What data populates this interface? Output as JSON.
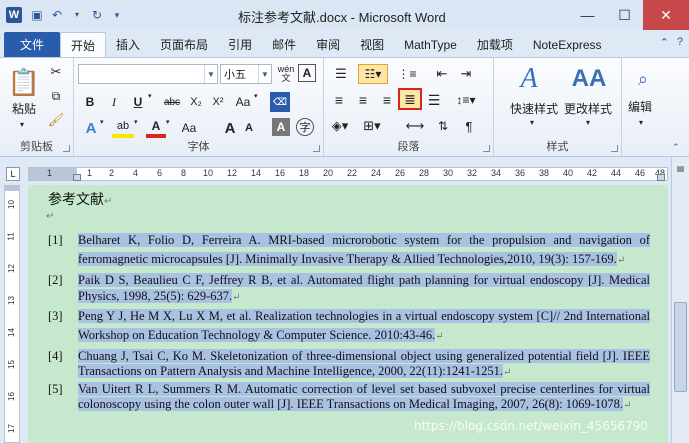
{
  "window": {
    "title": "标注参考文献.docx - Microsoft Word",
    "app_letter": "W"
  },
  "tabs": [
    "文件",
    "开始",
    "插入",
    "页面布局",
    "引用",
    "邮件",
    "审阅",
    "视图",
    "MathType",
    "加载项",
    "NoteExpress"
  ],
  "active_tab": "开始",
  "ribbon": {
    "clipboard": {
      "label": "剪贴板",
      "paste_label": "粘贴"
    },
    "font": {
      "label": "字体",
      "font_name": "",
      "font_size": "小五",
      "wen_label": "wén",
      "bold": "B",
      "italic": "I",
      "underline": "U",
      "strike": "abc",
      "sub": "X₂",
      "sup": "X²",
      "aa": "Aa",
      "grow": "A",
      "shrink": "A",
      "a_box": "A",
      "zi": "字"
    },
    "paragraph": {
      "label": "段落"
    },
    "styles": {
      "label": "样式",
      "quick_styles": "快速样式",
      "change_styles": "更改样式"
    },
    "editing": {
      "label": "编辑"
    }
  },
  "ruler": {
    "h_nums": [
      "1",
      "1",
      "2",
      "4",
      "6",
      "8",
      "10",
      "12",
      "14",
      "16",
      "18",
      "20",
      "22",
      "24",
      "26",
      "28",
      "30",
      "32",
      "34",
      "36",
      "38",
      "40",
      "42",
      "44",
      "46",
      "48"
    ],
    "v_nums": [
      "10",
      "11",
      "12",
      "13",
      "14",
      "15",
      "16",
      "17"
    ]
  },
  "document": {
    "heading": "参考文献",
    "references": [
      {
        "num": "[1]",
        "text": "Belharet K, Folio D, Ferreira A. MRI-based microrobotic system for the propulsion and  navigation of ferromagnetic microcapsules [J]. Minimally Invasive Therapy & Allied Technologies,2010, 19(3): 157-169."
      },
      {
        "num": "[2]",
        "text": "Paik D S, Beaulieu C F, Jeffrey R B, et al. Automated flight path planning for virtual endoscopy [J]. Medical Physics, 1998, 25(5): 629-637."
      },
      {
        "num": "[3]",
        "text": "Peng Y J, He M X, Lu X M, et al. Realization technologies in a virtual endoscopy system [C]// 2nd International Workshop on Education Technology & Computer Science. 2010:43-46."
      },
      {
        "num": "[4]",
        "text": "Chuang J, Tsai C, Ko M. Skeletonization of three-dimensional object using generalized potential field [J]. IEEE Transactions on Pattern Analysis and Machine Intelligence, 2000, 22(11):1241-1251."
      },
      {
        "num": "[5]",
        "text": "Van Uitert R L, Summers R M. Automatic correction of level set based subvoxel precise centerlines for virtual colonoscopy using the colon outer wall [J]. IEEE Transactions on Medical Imaging, 2007, 26(8): 1069-1078."
      }
    ]
  },
  "watermark": "https://blog.csdn.net/weixin_45656790"
}
